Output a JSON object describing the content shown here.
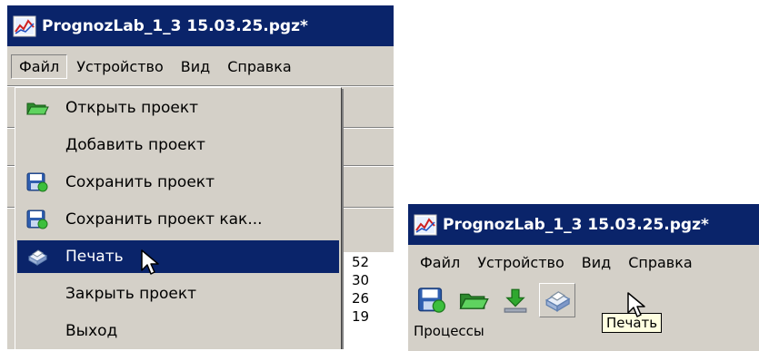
{
  "left_window": {
    "title": "PrognozLab_1_3 15.03.25.pgz*",
    "menu": [
      "Файл",
      "Устройство",
      "Вид",
      "Справка"
    ],
    "open_menu": "Файл",
    "dropdown": [
      {
        "label": "Открыть проект",
        "icon": "open-folder-icon"
      },
      {
        "label": "Добавить проект",
        "icon": ""
      },
      {
        "label": "Сохранить проект",
        "icon": "save-icon"
      },
      {
        "label": "Сохранить проект как...",
        "icon": "save-as-icon"
      },
      {
        "label": "Печать",
        "icon": "printer-icon",
        "highlighted": true
      },
      {
        "label": "Закрыть проект",
        "icon": ""
      },
      {
        "label": "Выход",
        "icon": ""
      }
    ],
    "grid_values": [
      "52",
      "30",
      "26",
      "19"
    ]
  },
  "right_window": {
    "title": "PrognozLab_1_3 15.03.25.pgz*",
    "menu": [
      "Файл",
      "Устройство",
      "Вид",
      "Справка"
    ],
    "toolbar": [
      {
        "icon": "save-icon"
      },
      {
        "icon": "open-folder-icon"
      },
      {
        "icon": "download-arrow-icon"
      },
      {
        "icon": "printer-icon",
        "hot": true
      }
    ],
    "tooltip": "Печать",
    "status_label": "Процессы"
  },
  "colors": {
    "titlebar": "#0a246a",
    "highlight": "#0a246a",
    "face": "#d4d0c8",
    "tooltip_bg": "#ffffe1"
  }
}
